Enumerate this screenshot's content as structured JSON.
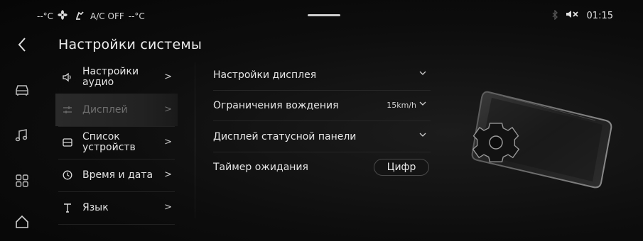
{
  "status": {
    "temp_left": "--°C",
    "ac": "A/C OFF",
    "temp_right": "--°C",
    "time": "01:15",
    "icons": [
      "fan-icon",
      "seat-heat-icon",
      "bluetooth-icon",
      "mute-icon"
    ]
  },
  "rail": {
    "items": [
      "back-icon",
      "car-icon",
      "music-icon",
      "apps-icon",
      "home-icon"
    ]
  },
  "page": {
    "title": "Настройки системы"
  },
  "submenu": {
    "items": [
      {
        "label": "Настройки аудио",
        "icon": "speaker-icon",
        "active": false
      },
      {
        "label": "Дисплей",
        "icon": "sliders-icon",
        "active": true
      },
      {
        "label": "Список устройств",
        "icon": "device-list-icon",
        "active": false
      },
      {
        "label": "Время и дата",
        "icon": "clock-icon",
        "active": false
      },
      {
        "label": "Язык",
        "icon": "text-icon",
        "active": false
      }
    ],
    "chevron": ">"
  },
  "settings": {
    "rows": [
      {
        "label": "Настройки дисплея"
      },
      {
        "label": "Ограничения вождения",
        "value": "15km/h"
      },
      {
        "label": "Дисплей статусной панели"
      },
      {
        "label": "Таймер ожидания",
        "value": "Цифр"
      }
    ]
  },
  "colors": {
    "background": "#0a0a0a",
    "text": "#e6e6e6",
    "dim": "#6e6e6e"
  }
}
